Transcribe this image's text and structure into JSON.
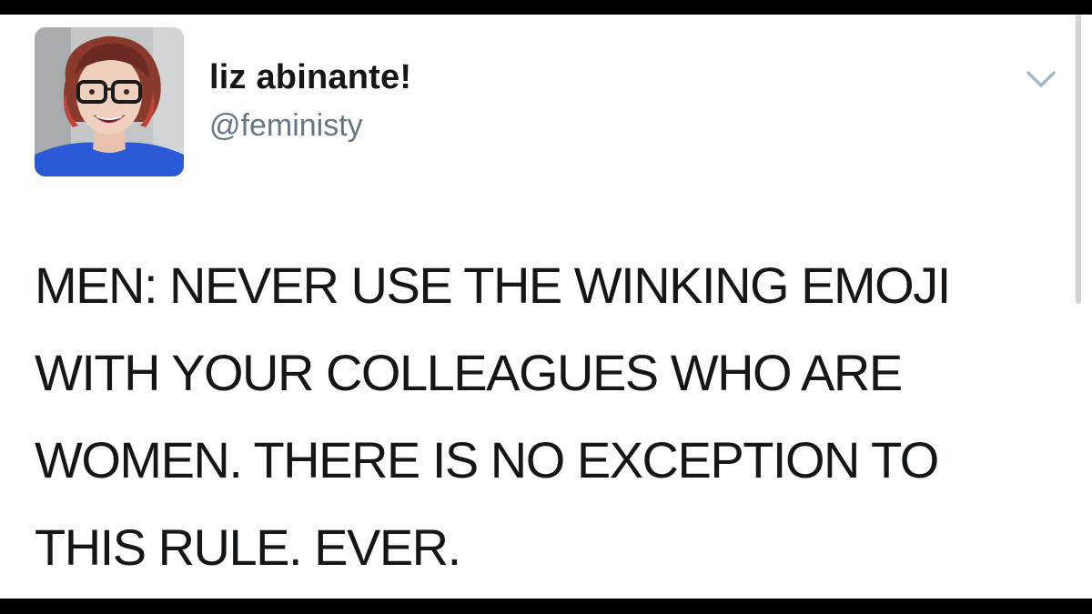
{
  "tweet": {
    "author": {
      "display_name": "liz abinante!",
      "handle": "@feministy",
      "avatar": "profile-photo"
    },
    "menu_icon": "chevron-down-icon",
    "text_lines": [
      "MEN: NEVER USE THE WINKING EMOJI",
      "WITH YOUR COLLEAGUES WHO ARE",
      "WOMEN. THERE IS NO EXCEPTION TO",
      "THIS RULE. EVER."
    ]
  },
  "colors": {
    "background": "#ffffff",
    "border": "#000000",
    "text": "#14171a",
    "secondary_text": "#657786",
    "chevron": "#aab8c2"
  }
}
